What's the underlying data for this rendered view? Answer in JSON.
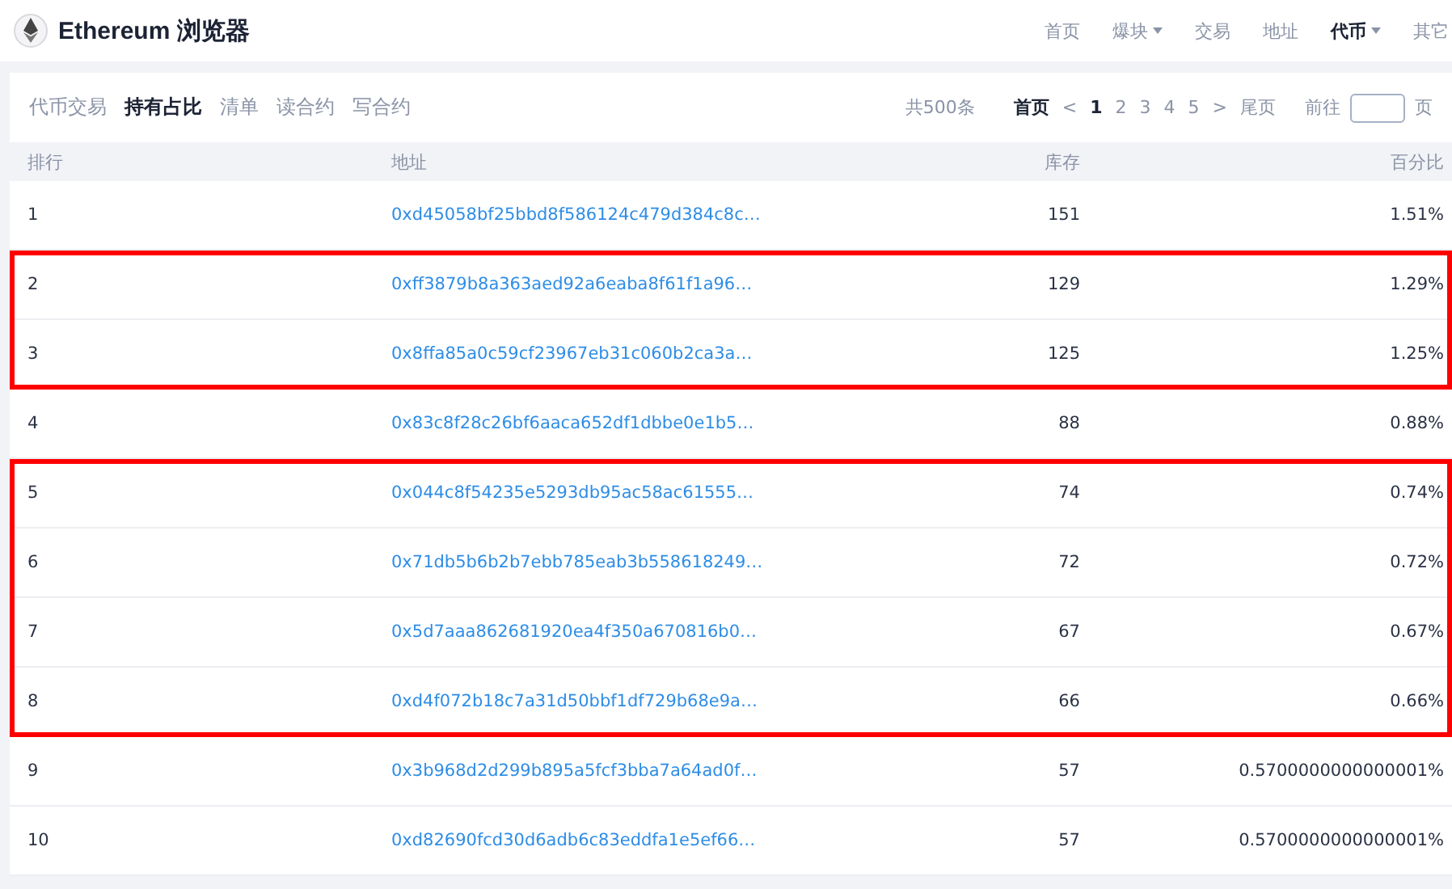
{
  "header": {
    "title": "Ethereum 浏览器",
    "nav": [
      {
        "label": "首页",
        "selected": false,
        "dropdown": false
      },
      {
        "label": "爆块",
        "selected": false,
        "dropdown": true
      },
      {
        "label": "交易",
        "selected": false,
        "dropdown": false
      },
      {
        "label": "地址",
        "selected": false,
        "dropdown": false
      },
      {
        "label": "代币",
        "selected": true,
        "dropdown": true
      },
      {
        "label": "其它",
        "selected": false,
        "dropdown": false
      }
    ]
  },
  "tabs": [
    {
      "label": "代币交易",
      "selected": false
    },
    {
      "label": "持有占比",
      "selected": true
    },
    {
      "label": "清单",
      "selected": false
    },
    {
      "label": "读合约",
      "selected": false
    },
    {
      "label": "写合约",
      "selected": false
    }
  ],
  "pagination": {
    "total": "共500条",
    "first": "首页",
    "prev": "<",
    "pages": [
      {
        "label": "1",
        "selected": true
      },
      {
        "label": "2",
        "selected": false
      },
      {
        "label": "3",
        "selected": false
      },
      {
        "label": "4",
        "selected": false
      },
      {
        "label": "5",
        "selected": false
      }
    ],
    "next": ">",
    "last": "尾页",
    "goto": "前往",
    "page_suffix": "页"
  },
  "table": {
    "columns": [
      "排行",
      "地址",
      "库存",
      "百分比"
    ],
    "row_groups": [
      {
        "highlighted": false,
        "rows": [
          {
            "rank": "1",
            "address": "0xd45058bf25bbd8f586124c479d384c8c…",
            "amount": "151",
            "percent": "1.51%"
          }
        ]
      },
      {
        "highlighted": true,
        "rows": [
          {
            "rank": "2",
            "address": "0xff3879b8a363aed92a6eaba8f61f1a96…",
            "amount": "129",
            "percent": "1.29%"
          },
          {
            "rank": "3",
            "address": "0x8ffa85a0c59cf23967eb31c060b2ca3a…",
            "amount": "125",
            "percent": "1.25%"
          }
        ]
      },
      {
        "highlighted": false,
        "rows": [
          {
            "rank": "4",
            "address": "0x83c8f28c26bf6aaca652df1dbbe0e1b5…",
            "amount": "88",
            "percent": "0.88%"
          }
        ]
      },
      {
        "highlighted": true,
        "rows": [
          {
            "rank": "5",
            "address": "0x044c8f54235e5293db95ac58ac61555…",
            "amount": "74",
            "percent": "0.74%"
          },
          {
            "rank": "6",
            "address": "0x71db5b6b2b7ebb785eab3b558618249…",
            "amount": "72",
            "percent": "0.72%"
          },
          {
            "rank": "7",
            "address": "0x5d7aaa862681920ea4f350a670816b0…",
            "amount": "67",
            "percent": "0.67%"
          },
          {
            "rank": "8",
            "address": "0xd4f072b18c7a31d50bbf1df729b68e9a…",
            "amount": "66",
            "percent": "0.66%"
          }
        ]
      },
      {
        "highlighted": false,
        "rows": [
          {
            "rank": "9",
            "address": "0x3b968d2d299b895a5fcf3bba7a64ad0f…",
            "amount": "57",
            "percent": "0.5700000000000001%"
          },
          {
            "rank": "10",
            "address": "0xd82690fcd30d6adb6c83eddfa1e5ef66…",
            "amount": "57",
            "percent": "0.5700000000000001%"
          }
        ]
      }
    ]
  }
}
